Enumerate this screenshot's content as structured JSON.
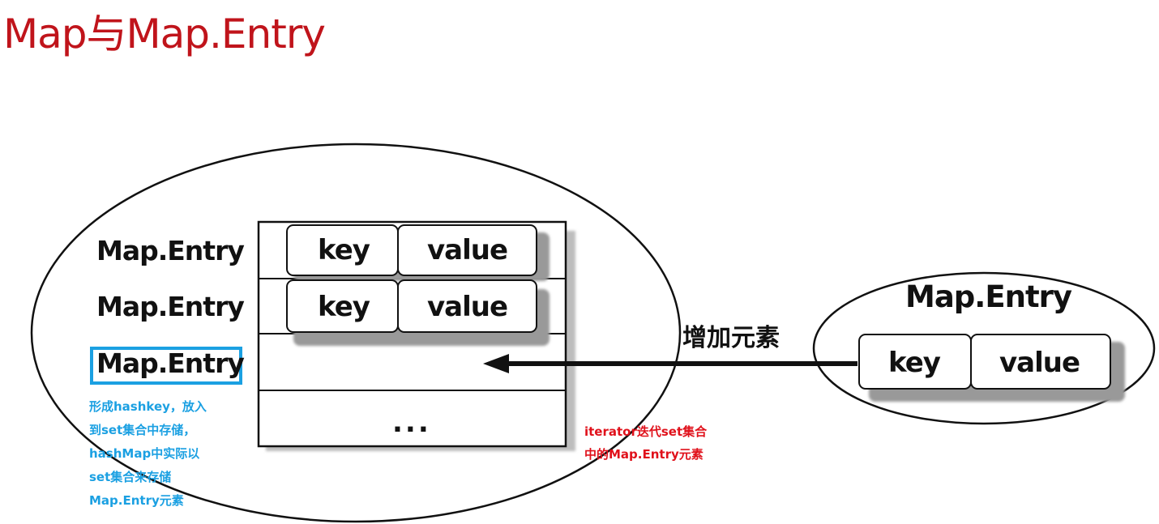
{
  "title": "Map与Map.Entry",
  "set_area": {
    "rows": [
      {
        "entry_label": "Map.Entry",
        "key": "key",
        "value": "value"
      },
      {
        "entry_label": "Map.Entry",
        "key": "key",
        "value": "value"
      },
      {
        "entry_label": "Map.Entry"
      }
    ],
    "ellipsis": "..."
  },
  "new_entry": {
    "label": "Map.Entry",
    "key": "key",
    "value": "value"
  },
  "arrow_label": "增加元素",
  "note_blue": {
    "lines": [
      "形成hashkey，放入",
      "到set集合中存储，",
      "hashMap中实际以",
      "set集合来存储",
      "Map.Entry元素"
    ]
  },
  "note_red": {
    "lines": [
      "iterator迭代set集合",
      "中的Map.Entry元素"
    ]
  },
  "colors": {
    "title": "#c0141b",
    "highlight_box": "#1ba0e2",
    "note_blue": "#1ba0e2",
    "note_red": "#e0111b"
  }
}
